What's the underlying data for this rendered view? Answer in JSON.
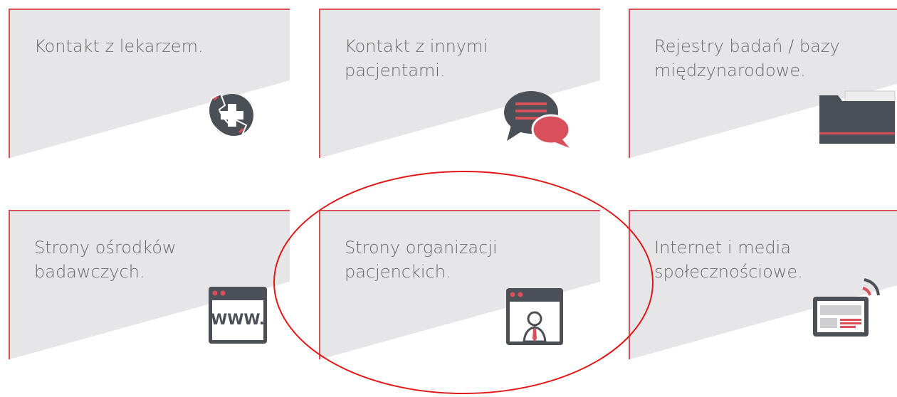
{
  "cards": [
    {
      "lines": [
        "Kontakt z lekarzem."
      ],
      "icon": "phone-medical-icon"
    },
    {
      "lines": [
        "Kontakt z innymi",
        "pacjentami."
      ],
      "icon": "chat-bubbles-icon"
    },
    {
      "lines": [
        "Rejestry badań / bazy",
        "międzynarodowe."
      ],
      "icon": "folder-icon"
    },
    {
      "lines": [
        "Strony ośrodków",
        "badawczych."
      ],
      "icon": "www-window-icon"
    },
    {
      "lines": [
        "Strony organizacji",
        "pacjenckich."
      ],
      "icon": "person-window-icon"
    },
    {
      "lines": [
        "Internet i media",
        "społecznościowe."
      ],
      "icon": "wireless-screen-icon"
    }
  ],
  "colors": {
    "accent": "#d8505c",
    "panel": "#e6e6e8",
    "icon_dark": "#4b4f56",
    "text": "#6a6a6a",
    "highlight": "#e01818"
  },
  "highlight": {
    "target": "Strony organizacji pacjenckich."
  },
  "www_text": "WWW."
}
